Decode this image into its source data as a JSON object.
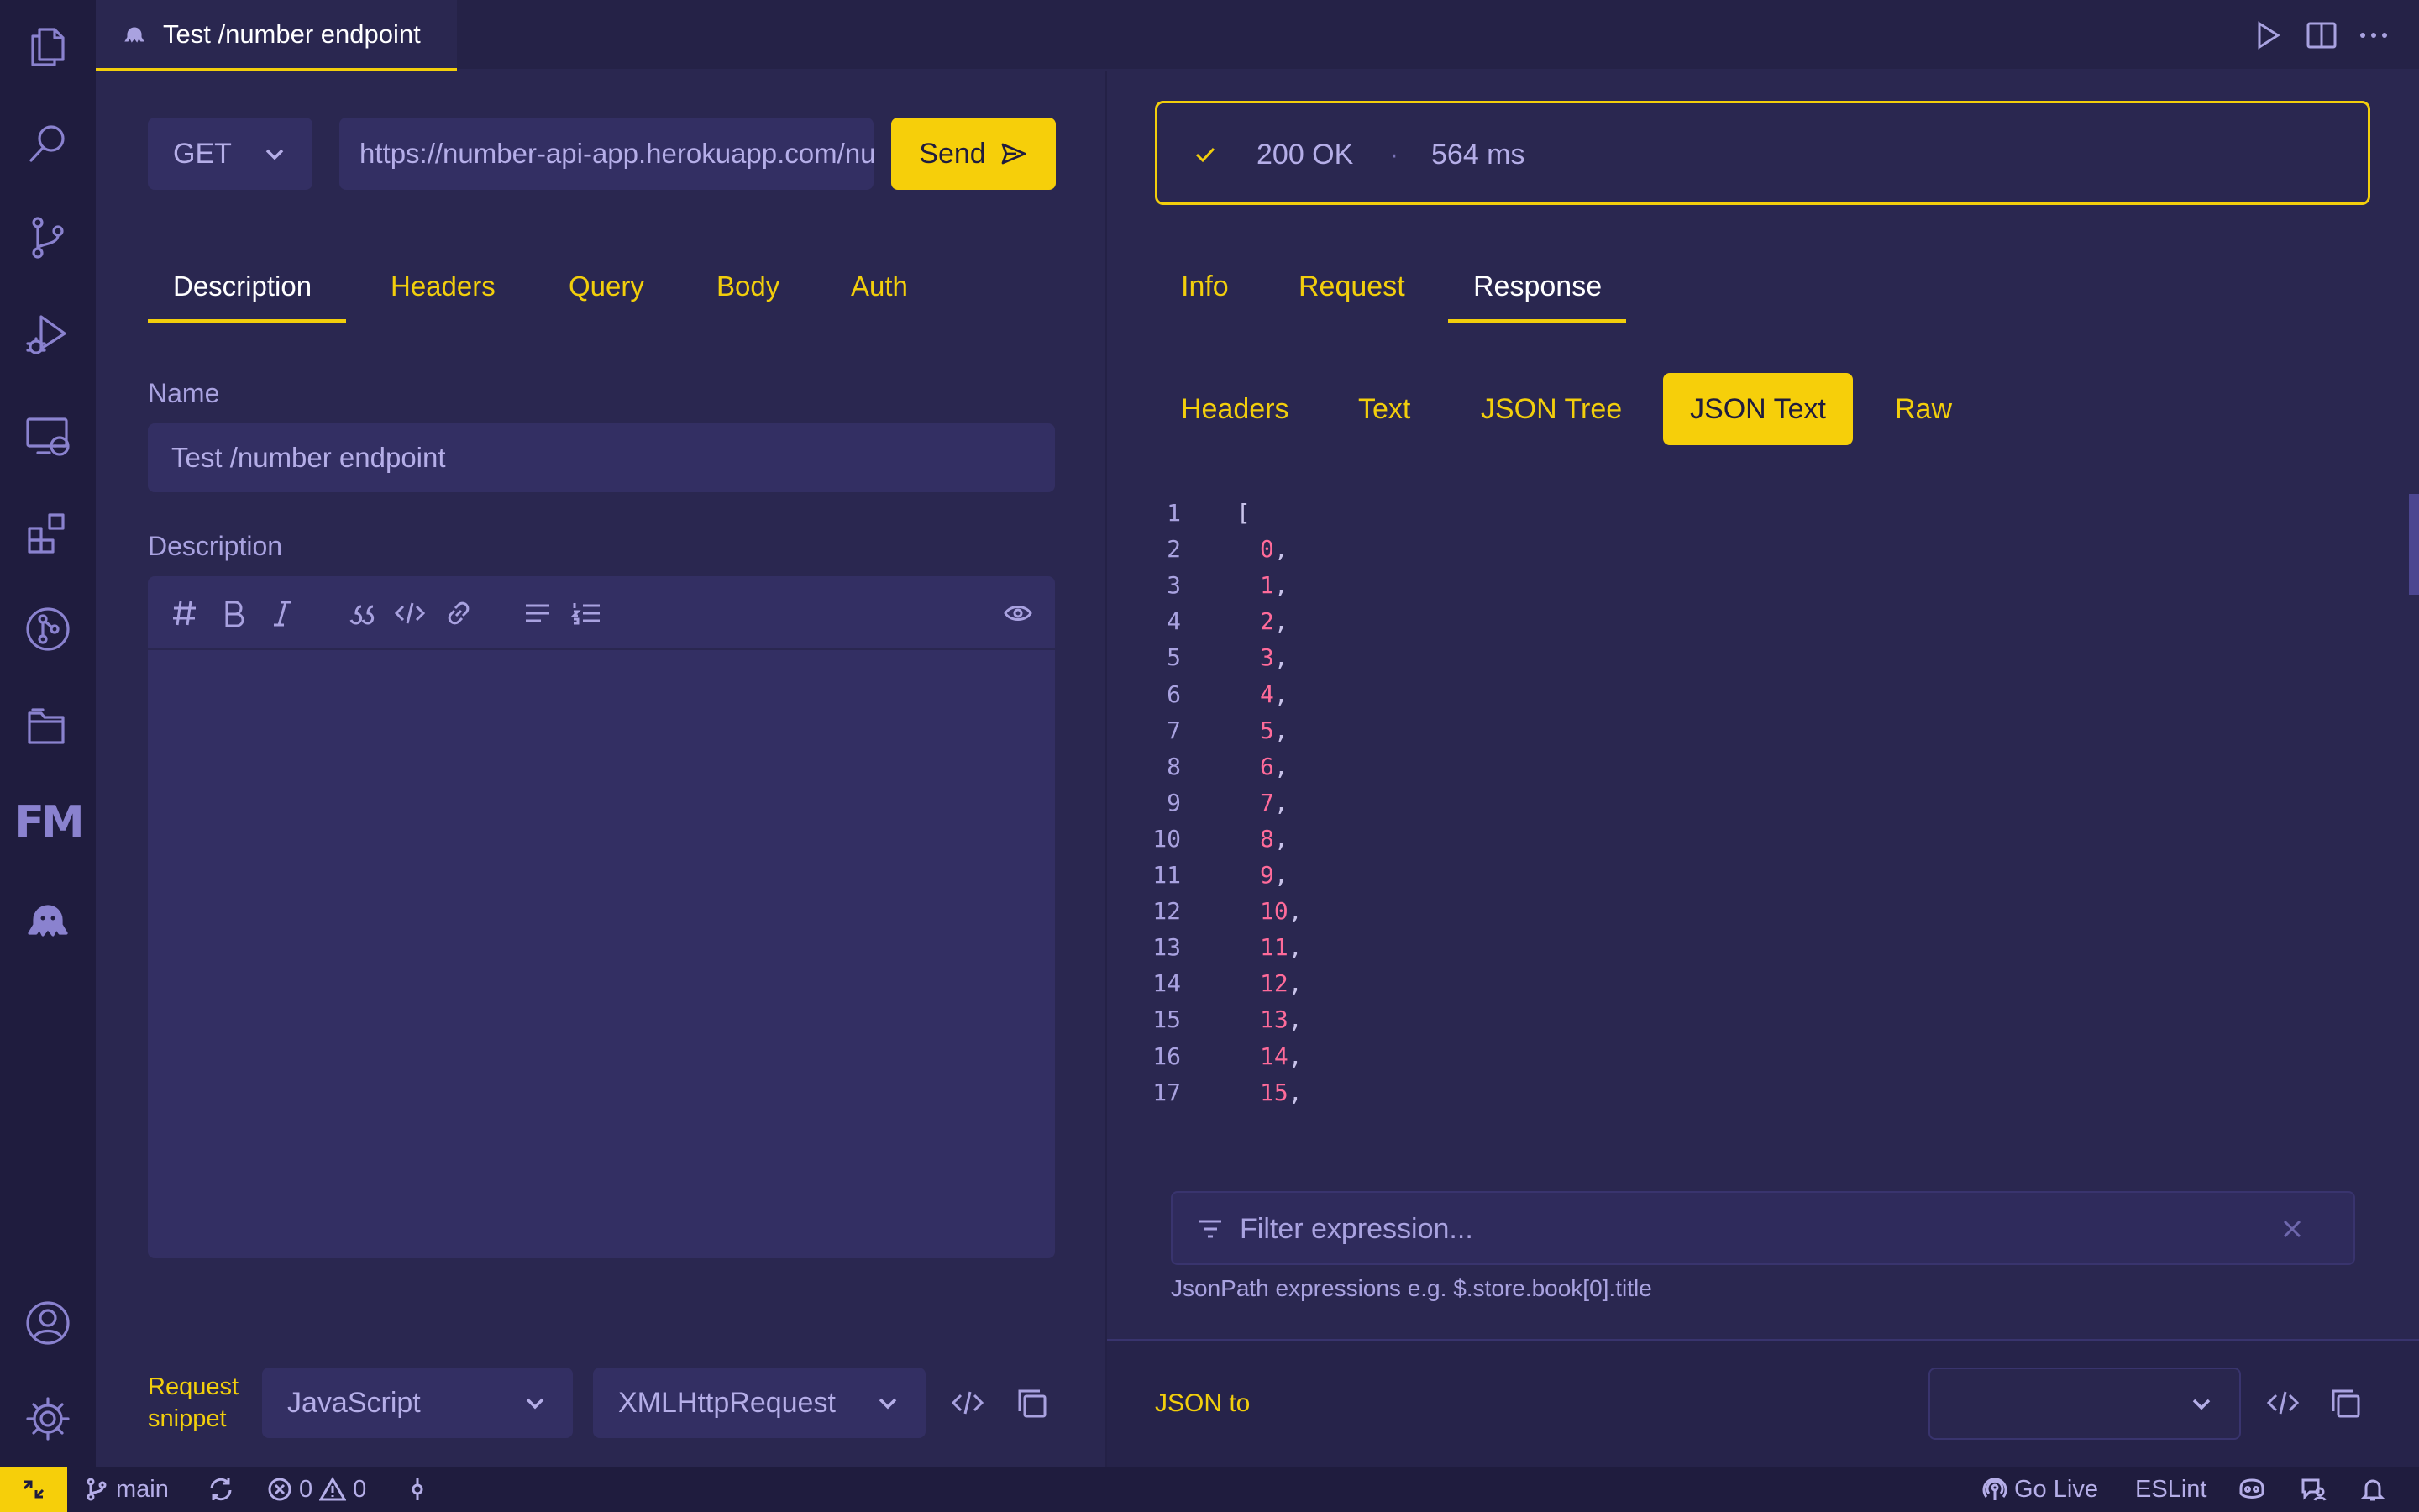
{
  "colors": {
    "accent": "#f6cf0a",
    "background": "#2a2750",
    "activity_bar": "#1f1c3e",
    "number_value": "#ff6b9a"
  },
  "activity_bar": {
    "items": [
      "explorer-icon",
      "search-icon",
      "source-control-icon",
      "run-debug-icon",
      "remote-explorer-icon",
      "extensions-icon",
      "git-graph-icon",
      "project-manager-icon",
      "front-matter-icon",
      "thunder-client-icon"
    ],
    "fm_label": "FM",
    "bottom_items": [
      "accounts-icon",
      "settings-gear-icon"
    ]
  },
  "tab": {
    "title": "Test /number endpoint",
    "icon": "thunder-client-icon"
  },
  "title_actions": [
    "run-icon",
    "split-editor-icon",
    "more-actions-icon"
  ],
  "request": {
    "method": "GET",
    "url": "https://number-api-app.herokuapp.com/number",
    "send_label": "Send",
    "tabs": [
      "Description",
      "Headers",
      "Query",
      "Body",
      "Auth"
    ],
    "active_tab": "Description",
    "name_label": "Name",
    "name_value": "Test /number endpoint",
    "description_label": "Description",
    "editor_toolbar": [
      "heading-icon",
      "bold-icon",
      "italic-icon",
      "quote-icon",
      "code-icon",
      "link-icon",
      "bullet-list-icon",
      "numbered-list-icon",
      "preview-eye-icon"
    ],
    "snippet_label": "Request snippet",
    "snippet_language": "JavaScript",
    "snippet_library": "XMLHttpRequest"
  },
  "response": {
    "status": "200 OK",
    "separator": "·",
    "time": "564 ms",
    "tabs": [
      "Info",
      "Request",
      "Response"
    ],
    "active_tab": "Response",
    "subtabs": [
      "Headers",
      "Text",
      "JSON Tree",
      "JSON Text",
      "Raw"
    ],
    "active_subtab": "JSON Text",
    "lines": [
      {
        "n": "1",
        "text": "["
      },
      {
        "n": "2",
        "val": "0"
      },
      {
        "n": "3",
        "val": "1"
      },
      {
        "n": "4",
        "val": "2"
      },
      {
        "n": "5",
        "val": "3"
      },
      {
        "n": "6",
        "val": "4"
      },
      {
        "n": "7",
        "val": "5"
      },
      {
        "n": "8",
        "val": "6"
      },
      {
        "n": "9",
        "val": "7"
      },
      {
        "n": "10",
        "val": "8"
      },
      {
        "n": "11",
        "val": "9"
      },
      {
        "n": "12",
        "val": "10"
      },
      {
        "n": "13",
        "val": "11"
      },
      {
        "n": "14",
        "val": "12"
      },
      {
        "n": "15",
        "val": "13"
      },
      {
        "n": "16",
        "val": "14"
      },
      {
        "n": "17",
        "val": "15"
      }
    ],
    "filter_placeholder": "Filter expression...",
    "filter_hint": "JsonPath expressions e.g. $.store.book[0].title",
    "json_to_label": "JSON to",
    "json_to_value": ""
  },
  "statusbar": {
    "branch": "main",
    "errors": "0",
    "warnings": "0",
    "go_live": "Go Live",
    "eslint": "ESLint"
  }
}
